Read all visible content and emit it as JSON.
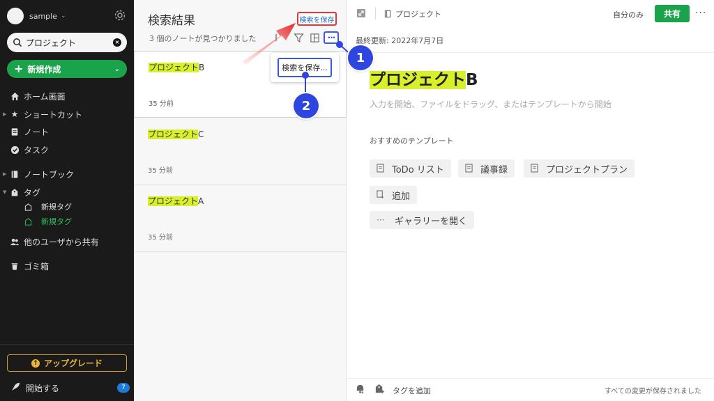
{
  "sidebar": {
    "account_name": "sample",
    "search_value": "プロジェクト",
    "new_label": "新規作成",
    "items": {
      "home": "ホーム画面",
      "shortcuts": "ショートカット",
      "notes": "ノート",
      "tasks": "タスク",
      "notebooks": "ノートブック",
      "tags": "タグ",
      "tag_1": "新規タグ",
      "tag_2": "新規タグ",
      "shared": "他のユーザから共有",
      "trash": "ゴミ箱"
    },
    "upgrade_label": "アップグレード",
    "start_label": "開始する",
    "start_badge": "7"
  },
  "results": {
    "title": "検索結果",
    "save_search_label": "検索を保存",
    "count_text": "3 個のノートが見つかりました",
    "notes": [
      {
        "highlight": "プロジェクト",
        "suffix": "B",
        "time": "35 分前"
      },
      {
        "highlight": "プロジェクト",
        "suffix": "C",
        "time": "35 分前"
      },
      {
        "highlight": "プロジェクト",
        "suffix": "A",
        "time": "35 分前"
      }
    ],
    "popup_item": "検索を保存..."
  },
  "editor": {
    "notebook": "プロジェクト",
    "visibility": "自分のみ",
    "share_label": "共有",
    "updated": "最終更新: 2022年7月7日",
    "title_highlight": "プロジェクト",
    "title_suffix": "B",
    "placeholder": "入力を開始、ファイルをドラッグ、またはテンプレートから開始",
    "templates_heading": "おすすめのテンプレート",
    "templates": [
      "ToDo リスト",
      "議事録",
      "プロジェクトプラン"
    ],
    "add_label": "追加",
    "gallery_label": "ギャラリーを開く",
    "add_tag": "タグを追加",
    "saved_status": "すべての変更が保存されました"
  },
  "steps": [
    "1",
    "2"
  ],
  "colors": {
    "accent": "#1aa34a",
    "step": "#2f45e0",
    "highlight": "#d8f02c",
    "arrow": "#e32a2a"
  }
}
